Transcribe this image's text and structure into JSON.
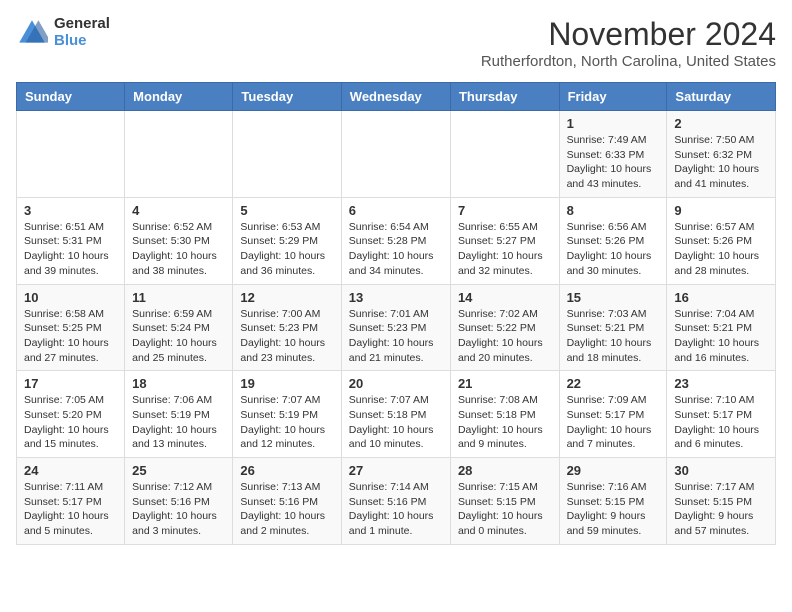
{
  "logo": {
    "general": "General",
    "blue": "Blue"
  },
  "title": "November 2024",
  "location": "Rutherfordton, North Carolina, United States",
  "weekdays": [
    "Sunday",
    "Monday",
    "Tuesday",
    "Wednesday",
    "Thursday",
    "Friday",
    "Saturday"
  ],
  "weeks": [
    [
      {
        "day": "",
        "info": ""
      },
      {
        "day": "",
        "info": ""
      },
      {
        "day": "",
        "info": ""
      },
      {
        "day": "",
        "info": ""
      },
      {
        "day": "",
        "info": ""
      },
      {
        "day": "1",
        "info": "Sunrise: 7:49 AM\nSunset: 6:33 PM\nDaylight: 10 hours and 43 minutes."
      },
      {
        "day": "2",
        "info": "Sunrise: 7:50 AM\nSunset: 6:32 PM\nDaylight: 10 hours and 41 minutes."
      }
    ],
    [
      {
        "day": "3",
        "info": "Sunrise: 6:51 AM\nSunset: 5:31 PM\nDaylight: 10 hours and 39 minutes."
      },
      {
        "day": "4",
        "info": "Sunrise: 6:52 AM\nSunset: 5:30 PM\nDaylight: 10 hours and 38 minutes."
      },
      {
        "day": "5",
        "info": "Sunrise: 6:53 AM\nSunset: 5:29 PM\nDaylight: 10 hours and 36 minutes."
      },
      {
        "day": "6",
        "info": "Sunrise: 6:54 AM\nSunset: 5:28 PM\nDaylight: 10 hours and 34 minutes."
      },
      {
        "day": "7",
        "info": "Sunrise: 6:55 AM\nSunset: 5:27 PM\nDaylight: 10 hours and 32 minutes."
      },
      {
        "day": "8",
        "info": "Sunrise: 6:56 AM\nSunset: 5:26 PM\nDaylight: 10 hours and 30 minutes."
      },
      {
        "day": "9",
        "info": "Sunrise: 6:57 AM\nSunset: 5:26 PM\nDaylight: 10 hours and 28 minutes."
      }
    ],
    [
      {
        "day": "10",
        "info": "Sunrise: 6:58 AM\nSunset: 5:25 PM\nDaylight: 10 hours and 27 minutes."
      },
      {
        "day": "11",
        "info": "Sunrise: 6:59 AM\nSunset: 5:24 PM\nDaylight: 10 hours and 25 minutes."
      },
      {
        "day": "12",
        "info": "Sunrise: 7:00 AM\nSunset: 5:23 PM\nDaylight: 10 hours and 23 minutes."
      },
      {
        "day": "13",
        "info": "Sunrise: 7:01 AM\nSunset: 5:23 PM\nDaylight: 10 hours and 21 minutes."
      },
      {
        "day": "14",
        "info": "Sunrise: 7:02 AM\nSunset: 5:22 PM\nDaylight: 10 hours and 20 minutes."
      },
      {
        "day": "15",
        "info": "Sunrise: 7:03 AM\nSunset: 5:21 PM\nDaylight: 10 hours and 18 minutes."
      },
      {
        "day": "16",
        "info": "Sunrise: 7:04 AM\nSunset: 5:21 PM\nDaylight: 10 hours and 16 minutes."
      }
    ],
    [
      {
        "day": "17",
        "info": "Sunrise: 7:05 AM\nSunset: 5:20 PM\nDaylight: 10 hours and 15 minutes."
      },
      {
        "day": "18",
        "info": "Sunrise: 7:06 AM\nSunset: 5:19 PM\nDaylight: 10 hours and 13 minutes."
      },
      {
        "day": "19",
        "info": "Sunrise: 7:07 AM\nSunset: 5:19 PM\nDaylight: 10 hours and 12 minutes."
      },
      {
        "day": "20",
        "info": "Sunrise: 7:07 AM\nSunset: 5:18 PM\nDaylight: 10 hours and 10 minutes."
      },
      {
        "day": "21",
        "info": "Sunrise: 7:08 AM\nSunset: 5:18 PM\nDaylight: 10 hours and 9 minutes."
      },
      {
        "day": "22",
        "info": "Sunrise: 7:09 AM\nSunset: 5:17 PM\nDaylight: 10 hours and 7 minutes."
      },
      {
        "day": "23",
        "info": "Sunrise: 7:10 AM\nSunset: 5:17 PM\nDaylight: 10 hours and 6 minutes."
      }
    ],
    [
      {
        "day": "24",
        "info": "Sunrise: 7:11 AM\nSunset: 5:17 PM\nDaylight: 10 hours and 5 minutes."
      },
      {
        "day": "25",
        "info": "Sunrise: 7:12 AM\nSunset: 5:16 PM\nDaylight: 10 hours and 3 minutes."
      },
      {
        "day": "26",
        "info": "Sunrise: 7:13 AM\nSunset: 5:16 PM\nDaylight: 10 hours and 2 minutes."
      },
      {
        "day": "27",
        "info": "Sunrise: 7:14 AM\nSunset: 5:16 PM\nDaylight: 10 hours and 1 minute."
      },
      {
        "day": "28",
        "info": "Sunrise: 7:15 AM\nSunset: 5:15 PM\nDaylight: 10 hours and 0 minutes."
      },
      {
        "day": "29",
        "info": "Sunrise: 7:16 AM\nSunset: 5:15 PM\nDaylight: 9 hours and 59 minutes."
      },
      {
        "day": "30",
        "info": "Sunrise: 7:17 AM\nSunset: 5:15 PM\nDaylight: 9 hours and 57 minutes."
      }
    ]
  ]
}
